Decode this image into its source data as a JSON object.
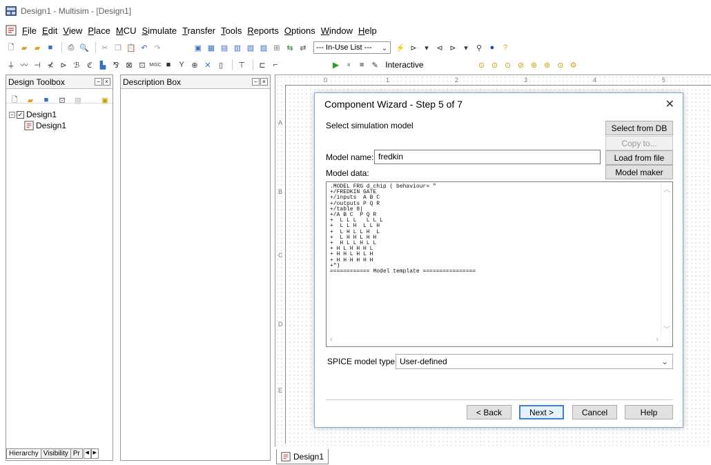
{
  "window": {
    "title": "Design1 - Multisim - [Design1]"
  },
  "menu": [
    "File",
    "Edit",
    "View",
    "Place",
    "MCU",
    "Simulate",
    "Transfer",
    "Tools",
    "Reports",
    "Options",
    "Window",
    "Help"
  ],
  "toolbar": {
    "in_use_list": "--- In-Use List ---",
    "interactive": "Interactive"
  },
  "toolbox": {
    "title": "Design Toolbox",
    "tree_root": "Design1",
    "tree_child": "Design1",
    "tabs": [
      "Hierarchy",
      "Visibility",
      "Pr"
    ]
  },
  "description_box": {
    "title": "Description Box"
  },
  "canvas": {
    "ruler_top": [
      "0",
      "1",
      "2",
      "3",
      "4",
      "5"
    ],
    "ruler_left": [
      "A",
      "B",
      "C",
      "D",
      "E"
    ],
    "tab": "Design1"
  },
  "dialog": {
    "title": "Component Wizard - Step 5 of 7",
    "subtitle": "Select simulation model",
    "model_name_label": "Model name:",
    "model_name_value": "fredkin",
    "model_data_label": "Model data:",
    "model_data_text": ".MODEL FRG d_chip ( behaviour= \"\n+/FREDKIN GATE\n+/inputs  A B C\n+/outputs P Q R\n+/table 8|\n+/A B C  P Q R\n+  L L L   L L L\n+  L L H  L L H\n+  L H L L H  L\n+  L H H L H H\n+  H L L H L L\n+ H L H H H L\n+ H H L H L H\n+ H H H H H H\n+\")\n============ Model template ================",
    "spice_label": "SPICE model type:",
    "spice_value": "User-defined",
    "buttons": {
      "select_from_db": "Select from DB",
      "copy_to": "Copy to...",
      "load_from_file": "Load from file",
      "model_maker": "Model maker",
      "back": "< Back",
      "next": "Next >",
      "cancel": "Cancel",
      "help": "Help"
    }
  }
}
